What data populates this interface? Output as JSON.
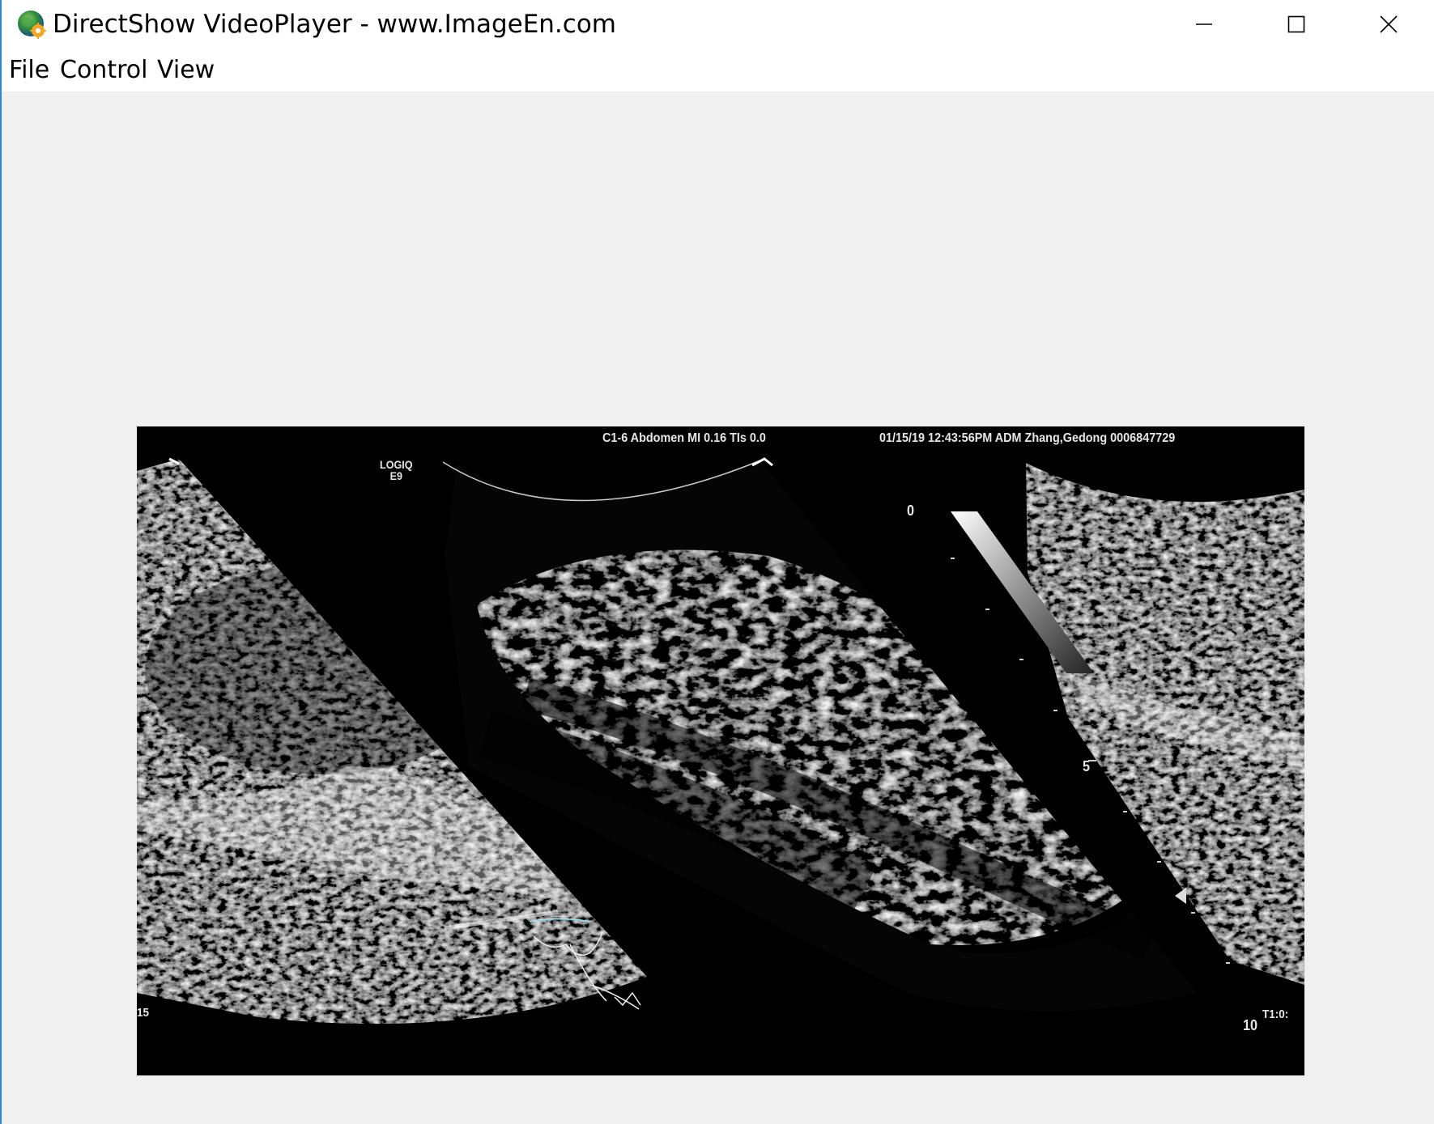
{
  "window": {
    "title": "DirectShow VideoPlayer - www.ImageEn.com",
    "icon": "globe-gear-icon",
    "controls": {
      "minimize_icon": "minimize-icon",
      "maximize_icon": "maximize-icon",
      "close_icon": "close-icon"
    }
  },
  "menu": {
    "items": [
      {
        "label": "File"
      },
      {
        "label": "Control"
      },
      {
        "label": "View"
      }
    ]
  },
  "video": {
    "overlay": {
      "probe_info": "C1-6  Abdomen  MI 0.16  TIs 0.0",
      "session_info": "01/15/19 12:43:56PM  ADM  Zhang,Gedong  0006847729",
      "logiq_line1": "LOGIQ",
      "logiq_line2": "E9",
      "depth_0": "0",
      "depth_5": "5",
      "depth_10": "10",
      "t1_label": "T1:0:",
      "left_marker": "15"
    }
  },
  "colors": {
    "accent_border": "#2b88d8",
    "title_bg": "#ffffff",
    "client_bg": "#f0f0f0",
    "video_bg": "#000000"
  }
}
